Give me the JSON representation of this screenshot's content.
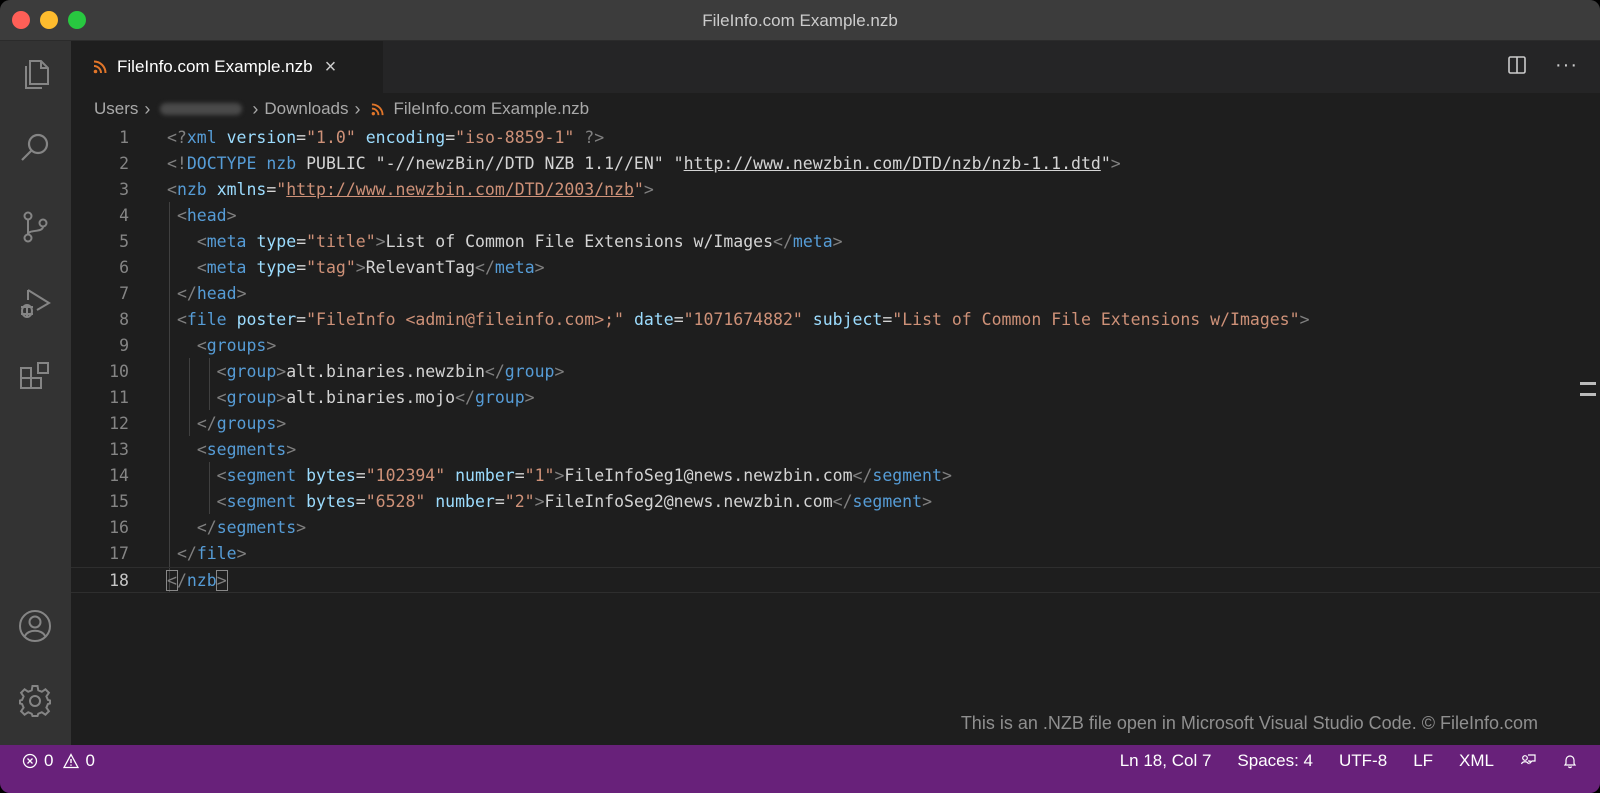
{
  "window": {
    "title": "FileInfo.com Example.nzb"
  },
  "activity_bar": {
    "icons": [
      "explorer-icon",
      "search-icon",
      "source-control-icon",
      "run-debug-icon",
      "extensions-icon",
      "account-icon",
      "settings-gear-icon"
    ]
  },
  "tab": {
    "label": "FileInfo.com Example.nzb",
    "close": "×"
  },
  "tab_actions": {
    "more": "···"
  },
  "breadcrumb": {
    "items": [
      "Users",
      "Downloads",
      "FileInfo.com Example.nzb"
    ],
    "separator": "›"
  },
  "editor": {
    "lines": [
      {
        "n": "1",
        "tokens": [
          [
            "p",
            "<?"
          ],
          [
            "t",
            "xml"
          ],
          [
            "x",
            " "
          ],
          [
            "a",
            "version"
          ],
          [
            "x",
            "="
          ],
          [
            "s",
            "\"1.0\""
          ],
          [
            "x",
            " "
          ],
          [
            "a",
            "encoding"
          ],
          [
            "x",
            "="
          ],
          [
            "s",
            "\"iso-8859-1\""
          ],
          [
            "x",
            " "
          ],
          [
            "p",
            "?>"
          ]
        ]
      },
      {
        "n": "2",
        "tokens": [
          [
            "p",
            "<!"
          ],
          [
            "t",
            "DOCTYPE"
          ],
          [
            "x",
            " "
          ],
          [
            "t",
            "nzb"
          ],
          [
            "x",
            " PUBLIC \"-//newzBin//DTD NZB 1.1//EN\" \""
          ],
          [
            "xu",
            "http://www.newzbin.com/DTD/nzb/nzb-1.1.dtd"
          ],
          [
            "x",
            "\""
          ],
          [
            "p",
            ">"
          ]
        ]
      },
      {
        "n": "3",
        "tokens": [
          [
            "p",
            "<"
          ],
          [
            "t",
            "nzb"
          ],
          [
            "x",
            " "
          ],
          [
            "a",
            "xmlns"
          ],
          [
            "x",
            "="
          ],
          [
            "s",
            "\""
          ],
          [
            "su",
            "http://www.newzbin.com/DTD/2003/nzb"
          ],
          [
            "s",
            "\""
          ],
          [
            "p",
            ">"
          ]
        ]
      },
      {
        "n": "4",
        "tokens": [
          [
            "x",
            " "
          ],
          [
            "p",
            "<"
          ],
          [
            "t",
            "head"
          ],
          [
            "p",
            ">"
          ]
        ]
      },
      {
        "n": "5",
        "tokens": [
          [
            "x",
            "   "
          ],
          [
            "p",
            "<"
          ],
          [
            "t",
            "meta"
          ],
          [
            "x",
            " "
          ],
          [
            "a",
            "type"
          ],
          [
            "x",
            "="
          ],
          [
            "s",
            "\"title\""
          ],
          [
            "p",
            ">"
          ],
          [
            "x",
            "List of Common File Extensions w/Images"
          ],
          [
            "p",
            "</"
          ],
          [
            "t",
            "meta"
          ],
          [
            "p",
            ">"
          ]
        ]
      },
      {
        "n": "6",
        "tokens": [
          [
            "x",
            "   "
          ],
          [
            "p",
            "<"
          ],
          [
            "t",
            "meta"
          ],
          [
            "x",
            " "
          ],
          [
            "a",
            "type"
          ],
          [
            "x",
            "="
          ],
          [
            "s",
            "\"tag\""
          ],
          [
            "p",
            ">"
          ],
          [
            "x",
            "RelevantTag"
          ],
          [
            "p",
            "</"
          ],
          [
            "t",
            "meta"
          ],
          [
            "p",
            ">"
          ]
        ]
      },
      {
        "n": "7",
        "tokens": [
          [
            "x",
            " "
          ],
          [
            "p",
            "</"
          ],
          [
            "t",
            "head"
          ],
          [
            "p",
            ">"
          ]
        ]
      },
      {
        "n": "8",
        "tokens": [
          [
            "x",
            " "
          ],
          [
            "p",
            "<"
          ],
          [
            "t",
            "file"
          ],
          [
            "x",
            " "
          ],
          [
            "a",
            "poster"
          ],
          [
            "x",
            "="
          ],
          [
            "s",
            "\"FileInfo <admin@fileinfo.com>;\""
          ],
          [
            "x",
            " "
          ],
          [
            "a",
            "date"
          ],
          [
            "x",
            "="
          ],
          [
            "s",
            "\"1071674882\""
          ],
          [
            "x",
            " "
          ],
          [
            "a",
            "subject"
          ],
          [
            "x",
            "="
          ],
          [
            "s",
            "\"List of Common File Extensions w/Images\""
          ],
          [
            "p",
            ">"
          ]
        ]
      },
      {
        "n": "9",
        "tokens": [
          [
            "x",
            "   "
          ],
          [
            "p",
            "<"
          ],
          [
            "t",
            "groups"
          ],
          [
            "p",
            ">"
          ]
        ]
      },
      {
        "n": "10",
        "tokens": [
          [
            "x",
            "     "
          ],
          [
            "p",
            "<"
          ],
          [
            "t",
            "group"
          ],
          [
            "p",
            ">"
          ],
          [
            "x",
            "alt.binaries.newzbin"
          ],
          [
            "p",
            "</"
          ],
          [
            "t",
            "group"
          ],
          [
            "p",
            ">"
          ]
        ]
      },
      {
        "n": "11",
        "tokens": [
          [
            "x",
            "     "
          ],
          [
            "p",
            "<"
          ],
          [
            "t",
            "group"
          ],
          [
            "p",
            ">"
          ],
          [
            "x",
            "alt.binaries.mojo"
          ],
          [
            "p",
            "</"
          ],
          [
            "t",
            "group"
          ],
          [
            "p",
            ">"
          ]
        ]
      },
      {
        "n": "12",
        "tokens": [
          [
            "x",
            "   "
          ],
          [
            "p",
            "</"
          ],
          [
            "t",
            "groups"
          ],
          [
            "p",
            ">"
          ]
        ]
      },
      {
        "n": "13",
        "tokens": [
          [
            "x",
            "   "
          ],
          [
            "p",
            "<"
          ],
          [
            "t",
            "segments"
          ],
          [
            "p",
            ">"
          ]
        ]
      },
      {
        "n": "14",
        "tokens": [
          [
            "x",
            "     "
          ],
          [
            "p",
            "<"
          ],
          [
            "t",
            "segment"
          ],
          [
            "x",
            " "
          ],
          [
            "a",
            "bytes"
          ],
          [
            "x",
            "="
          ],
          [
            "s",
            "\"102394\""
          ],
          [
            "x",
            " "
          ],
          [
            "a",
            "number"
          ],
          [
            "x",
            "="
          ],
          [
            "s",
            "\"1\""
          ],
          [
            "p",
            ">"
          ],
          [
            "x",
            "FileInfoSeg1@news.newzbin.com"
          ],
          [
            "p",
            "</"
          ],
          [
            "t",
            "segment"
          ],
          [
            "p",
            ">"
          ]
        ]
      },
      {
        "n": "15",
        "tokens": [
          [
            "x",
            "     "
          ],
          [
            "p",
            "<"
          ],
          [
            "t",
            "segment"
          ],
          [
            "x",
            " "
          ],
          [
            "a",
            "bytes"
          ],
          [
            "x",
            "="
          ],
          [
            "s",
            "\"6528\""
          ],
          [
            "x",
            " "
          ],
          [
            "a",
            "number"
          ],
          [
            "x",
            "="
          ],
          [
            "s",
            "\"2\""
          ],
          [
            "p",
            ">"
          ],
          [
            "x",
            "FileInfoSeg2@news.newzbin.com"
          ],
          [
            "p",
            "</"
          ],
          [
            "t",
            "segment"
          ],
          [
            "p",
            ">"
          ]
        ]
      },
      {
        "n": "16",
        "tokens": [
          [
            "x",
            "   "
          ],
          [
            "p",
            "</"
          ],
          [
            "t",
            "segments"
          ],
          [
            "p",
            ">"
          ]
        ]
      },
      {
        "n": "17",
        "tokens": [
          [
            "x",
            " "
          ],
          [
            "p",
            "</"
          ],
          [
            "t",
            "file"
          ],
          [
            "p",
            ">"
          ]
        ]
      },
      {
        "n": "18",
        "tokens": [
          [
            "pb",
            "<"
          ],
          [
            "p",
            "/"
          ],
          [
            "t",
            "nzb"
          ],
          [
            "pb",
            ">"
          ]
        ]
      }
    ],
    "current_line": "18"
  },
  "caption": "This is an .NZB file open in Microsoft Visual Studio Code. © FileInfo.com",
  "status_bar": {
    "errors": "0",
    "warnings": "0",
    "position": "Ln 18, Col 7",
    "spaces": "Spaces: 4",
    "encoding": "UTF-8",
    "eol": "LF",
    "language": "XML"
  },
  "colors": {
    "status_bar": "#68217a",
    "tag": "#569cd6",
    "attribute": "#9cdcfe",
    "string": "#ce9178",
    "rss_icon": "#e2762a"
  }
}
